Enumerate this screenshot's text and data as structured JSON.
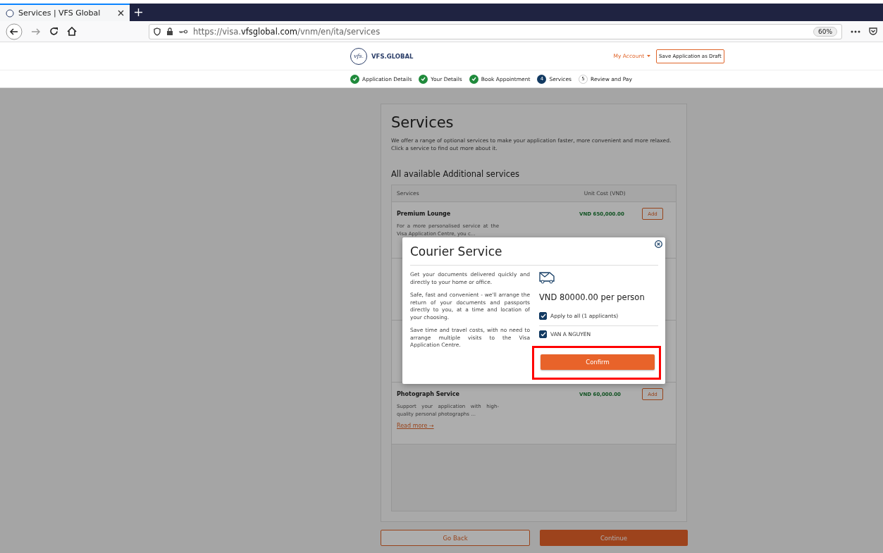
{
  "browser": {
    "tabs": [
      {
        "title": "Services | VFS Global",
        "selected": true
      }
    ],
    "url_prefix": "https://visa.",
    "url_domain": "vfsglobal.com",
    "url_path": "/vnm/en/ita/services",
    "zoom": "60%"
  },
  "header": {
    "logo_mark": "vfs.",
    "logo_text": "VFS.GLOBAL",
    "account": "My Account",
    "save_draft": "Save Application as Draft"
  },
  "steps": [
    {
      "label": "Application Details",
      "kind": "done"
    },
    {
      "label": "Your Details",
      "kind": "done"
    },
    {
      "label": "Book Appointment",
      "kind": "done"
    },
    {
      "label": "Services",
      "kind": "current",
      "number": "4"
    },
    {
      "label": "Review and Pay",
      "kind": "pending",
      "number": "5"
    }
  ],
  "page": {
    "title": "Services",
    "intro": "We offer a range of optional services to make your application faster, more convenient and more relaxed. Click a service to find out more about it.",
    "subtitle": "All available Additional services"
  },
  "table": {
    "columns": [
      "Services",
      "Unit Cost (VND)"
    ],
    "rows": [
      {
        "kind": "shown",
        "name": "Premium Lounge",
        "description": "For a more personalised service at the Visa Application Centre, you c...",
        "price": "VND 650,000.00",
        "action": "Add"
      },
      {
        "kind": "covered"
      },
      {
        "kind": "covered"
      },
      {
        "kind": "shown",
        "name": "Photograph Service",
        "description": "Support your application with high-quality personal photographs ...",
        "price": "VND 60,000.00",
        "action": "Add",
        "link": "Read more →"
      }
    ]
  },
  "buttons": {
    "back": "Go Back",
    "continue": "Continue"
  },
  "modal": {
    "title": "Courier Service",
    "paragraphs": [
      "Get your documents delivered quickly and directly to your home or office.",
      "Safe, fast and convenient - we'll arrange the return of your documents and passports directly to you, at a time and location of your choosing.",
      "Save time and travel costs, with no need to arrange multiple visits to the Visa Application Centre."
    ],
    "price": "VND 80000.00 per person",
    "options": [
      {
        "label": "Apply to all (1 applicants)",
        "checked": true
      },
      {
        "label": "VAN A NGUYEN",
        "checked": true
      }
    ],
    "confirm": "Confirm",
    "highlighted": true
  }
}
